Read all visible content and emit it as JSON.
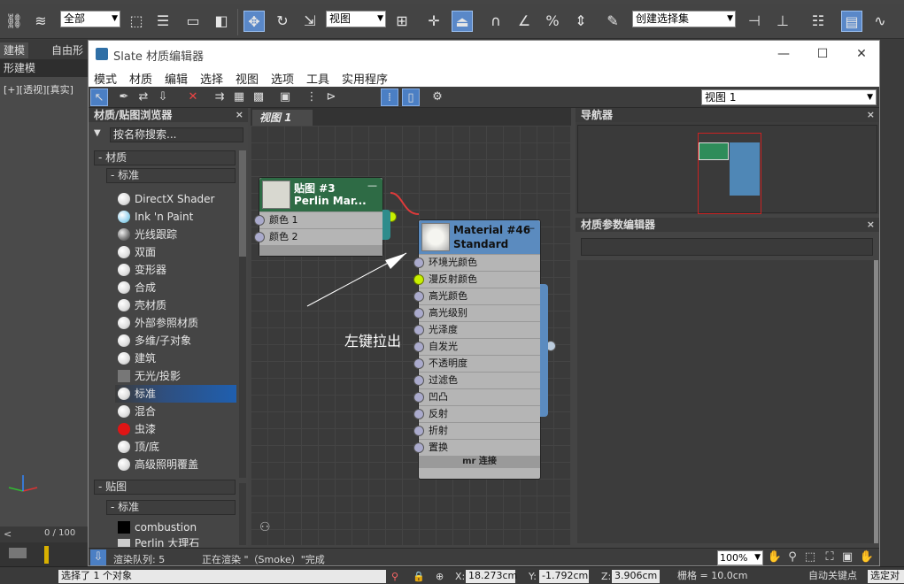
{
  "max": {
    "toolbar": {
      "selection_filter": "全部",
      "ref_coord": "视图",
      "named_selection": "创建选择集"
    },
    "ribbon_tabs": [
      "建模",
      "自由形"
    ],
    "ribbon_sub": "形建模",
    "viewport_label": "[+][透视][真实]",
    "time_frame": "0 / 100",
    "status": {
      "selected": "选择了 1 个对象",
      "x_label": "X:",
      "x_value": "18.273cm",
      "y_label": "Y:",
      "y_value": "-1.792cm",
      "z_label": "Z:",
      "z_value": "3.906cm",
      "grid": "栅格 = 10.0cm",
      "autokey": "自动关键点",
      "set_key": "选定对"
    }
  },
  "slate": {
    "title": "Slate 材质编辑器",
    "menu": [
      "模式",
      "材质",
      "编辑",
      "选择",
      "视图",
      "选项",
      "工具",
      "实用程序"
    ],
    "view_select": "视图 1",
    "browser": {
      "title": "材质/贴图浏览器",
      "search_placeholder": "按名称搜索...",
      "cat_materials": "- 材质",
      "sub_standard": "- 标准",
      "materials": [
        "DirectX Shader",
        "Ink 'n Paint",
        "光线跟踪",
        "双面",
        "变形器",
        "合成",
        "壳材质",
        "外部参照材质",
        "多维/子对象",
        "建筑",
        "无光/投影",
        "标准",
        "混合",
        "虫漆",
        "顶/底",
        "高级照明覆盖"
      ],
      "cat_maps": "- 贴图",
      "sub_maps_standard": "- 标准",
      "maps": [
        "combustion",
        "Perlin 大理石"
      ]
    },
    "view_tab": "视图 1",
    "nodes": {
      "map": {
        "title1": "贴图 #3",
        "title2": "Perlin Mar...",
        "slots": [
          "颜色 1",
          "颜色 2"
        ]
      },
      "material": {
        "title1": "Material #46",
        "title2": "Standard",
        "slots": [
          "环境光颜色",
          "漫反射颜色",
          "高光颜色",
          "高光级别",
          "光泽度",
          "自发光",
          "不透明度",
          "过滤色",
          "凹凸",
          "反射",
          "折射",
          "置换"
        ],
        "footer": "mr 连接"
      }
    },
    "annotation": "左键拉出",
    "navigator_title": "导航器",
    "param_title": "材质参数编辑器",
    "status": {
      "queue": "渲染队列: 5",
      "rendering": "正在渲染 \"（Smoke）\"完成",
      "zoom": "100%"
    }
  },
  "colors": {
    "map_header": "#2e6b45",
    "material_header": "#5b8bbf",
    "wire": "#e03a3a",
    "active_port": "#c8f000"
  }
}
